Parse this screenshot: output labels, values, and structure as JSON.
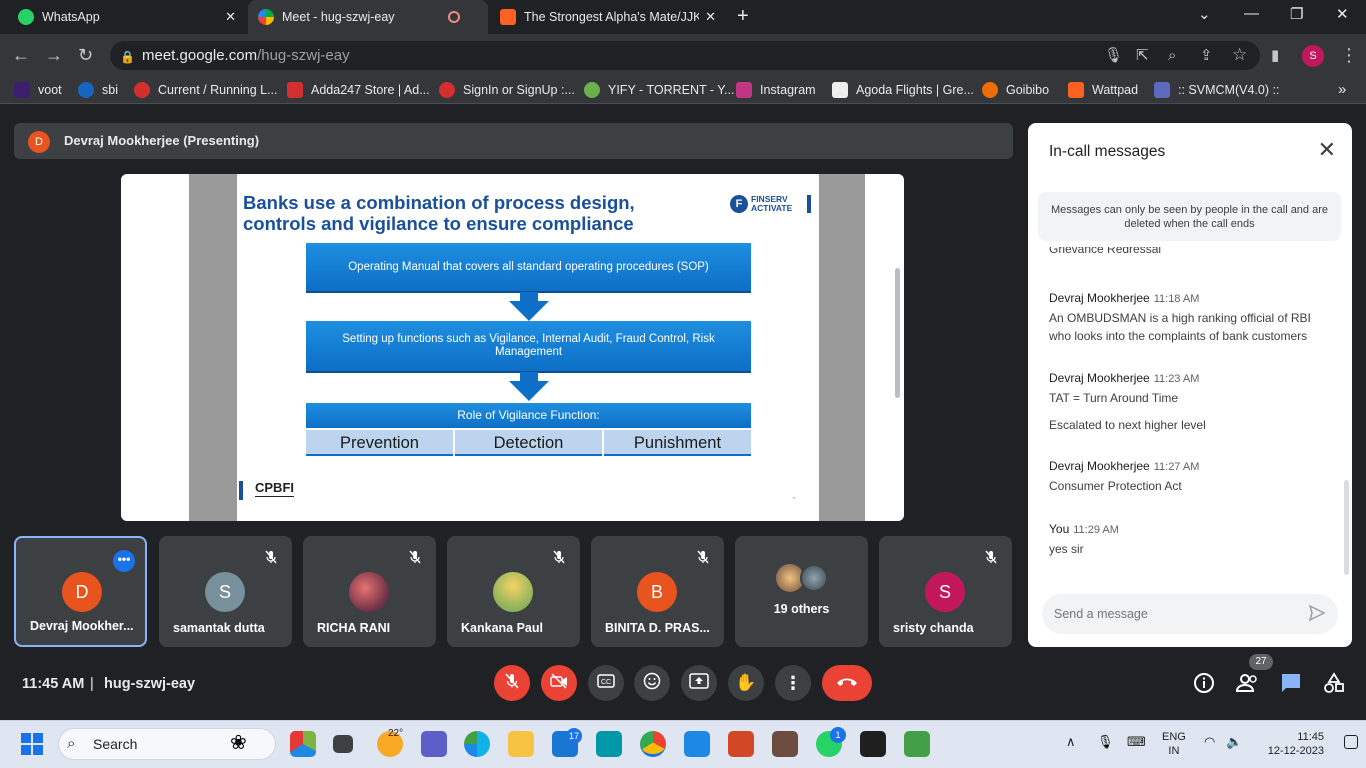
{
  "browser": {
    "tabs": [
      {
        "title": "WhatsApp",
        "color": "#25d366"
      },
      {
        "title": "Meet - hug-szwj-eay",
        "color": "#00ac47"
      },
      {
        "title": "The Strongest Alpha's Mate/JJK",
        "color": "#ff6122"
      }
    ],
    "url_host": "meet.google.com",
    "url_path": "/hug-szwj-eay",
    "profile_initial": "S",
    "bookmarks": [
      {
        "label": "voot",
        "color": "#3b1e6e"
      },
      {
        "label": "sbi",
        "color": "#1565c0"
      },
      {
        "label": "Current / Running L...",
        "color": "#d32f2f"
      },
      {
        "label": "Adda247 Store | Ad...",
        "color": "#d32f2f"
      },
      {
        "label": "SignIn or SignUp :...",
        "color": "#d32f2f"
      },
      {
        "label": "YIFY - TORRENT - Y...",
        "color": "#6ab04c"
      },
      {
        "label": "Instagram",
        "color": "#c13584"
      },
      {
        "label": "Agoda Flights | Gre...",
        "color": "#eeeeee"
      },
      {
        "label": "Goibibo",
        "color": "#ef6c00"
      },
      {
        "label": "Wattpad",
        "color": "#ff6122"
      },
      {
        "label": ":: SVMCM(V4.0) ::",
        "color": "#5c6bc0"
      }
    ],
    "more_bookmarks": "»"
  },
  "meet": {
    "presenter": {
      "initial": "D",
      "label": "Devraj Mookherjee (Presenting)"
    },
    "slide": {
      "title": "Banks use a combination of process design, controls and vigilance to ensure compliance",
      "logo_text": "FINSERV\nACTIVATE",
      "logo_line1": "FINSERV",
      "logo_line2": "ACTIVATE",
      "box1": "Operating Manual that covers all standard operating procedures (SOP)",
      "box2": "Setting up functions such as Vigilance, Internal Audit, Fraud Control, Risk Management",
      "role_title": "Role of Vigilance Function:",
      "roles": [
        "Prevention",
        "Detection",
        "Punishment"
      ],
      "footer": "CPBFI",
      "page_mark": "\""
    },
    "participants": [
      {
        "name": "Devraj Mookher...",
        "initial": "D",
        "color": "#e8531e"
      },
      {
        "name": "samantak dutta",
        "initial": "S",
        "color": "#78909c"
      },
      {
        "name": "RICHA RANI",
        "initial": "",
        "color": "#8d4b5f"
      },
      {
        "name": "Kankana Paul",
        "initial": "",
        "color": "#9ab05a"
      },
      {
        "name": "BINITA D. PRAS...",
        "initial": "B",
        "color": "#e8531e"
      },
      {
        "name": "19 others",
        "initial": "",
        "color": "#5f6368"
      },
      {
        "name": "sristy chanda",
        "initial": "S",
        "color": "#c2185b"
      }
    ],
    "time": "11:45 AM",
    "separator": "|",
    "meeting_code": "hug-szwj-eay",
    "people_count": "27"
  },
  "chat": {
    "title": "In-call messages",
    "notice": "Messages can only be seen by people in the call and are deleted when the call ends",
    "clipped_text": "Grievance Redressal",
    "messages": [
      {
        "sender": "Devraj Mookherjee",
        "time": "11:18 AM",
        "lines": [
          "An OMBUDSMAN is a high ranking official of RBI who looks into the complaints of bank customers"
        ]
      },
      {
        "sender": "Devraj Mookherjee",
        "time": "11:23 AM",
        "lines": [
          "TAT = Turn Around Time",
          "Escalated to next higher level"
        ]
      },
      {
        "sender": "Devraj Mookherjee",
        "time": "11:27 AM",
        "lines": [
          "Consumer Protection Act"
        ]
      },
      {
        "sender": "You",
        "time": "11:29 AM",
        "lines": [
          "yes sir"
        ]
      }
    ],
    "input_placeholder": "Send a message"
  },
  "taskbar": {
    "search_label": "Search",
    "weather_temp": "22°",
    "mail_badge": "17",
    "whatsapp_badge": "1",
    "lang_line1": "ENG",
    "lang_line2": "IN",
    "time": "11:45",
    "date": "12-12-2023"
  }
}
